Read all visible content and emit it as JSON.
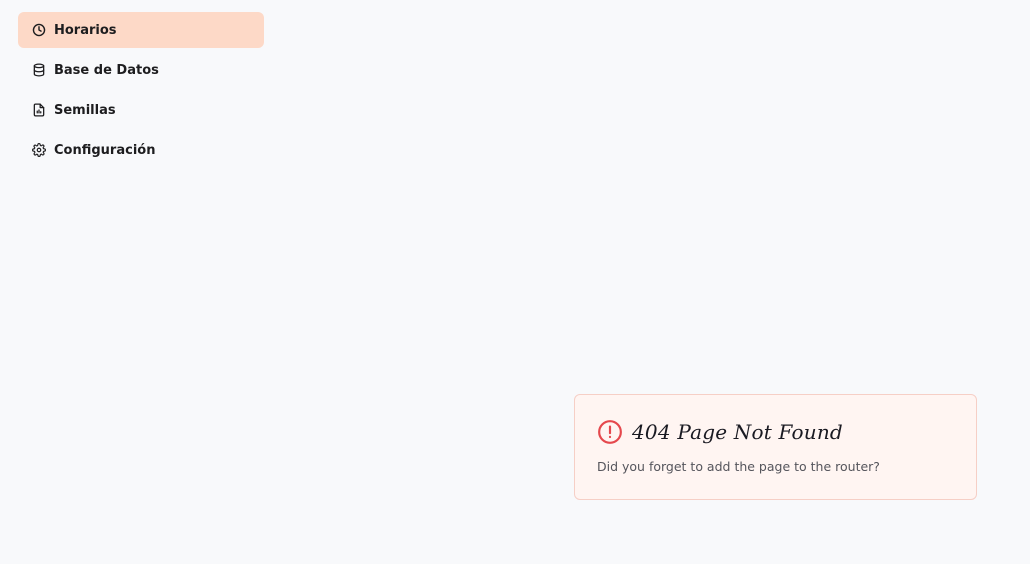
{
  "sidebar": {
    "items": [
      {
        "label": "Horarios",
        "icon": "clock-icon",
        "active": true
      },
      {
        "label": "Base de Datos",
        "icon": "database-icon",
        "active": false
      },
      {
        "label": "Semillas",
        "icon": "file-icon",
        "active": false
      },
      {
        "label": "Configuración",
        "icon": "gear-icon",
        "active": false
      }
    ]
  },
  "alert": {
    "icon": "alert-circle-icon",
    "title": "404 Page Not Found",
    "message": "Did you forget to add the page to the router?",
    "accent_color": "#e5484d",
    "background_color": "#fff5f2"
  },
  "colors": {
    "active_item_bg": "#fdd9c7",
    "page_bg": "#f8f9fb"
  }
}
